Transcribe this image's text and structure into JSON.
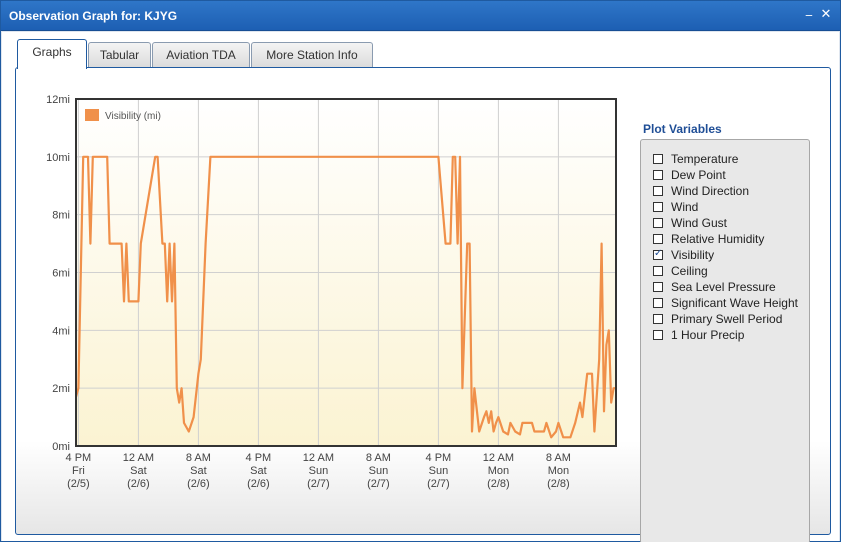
{
  "window": {
    "title": "Observation Graph for: KJYG",
    "minimize_icon": "minimize-icon",
    "close_icon": "close-icon"
  },
  "tabs": [
    {
      "label": "Graphs",
      "active": true
    },
    {
      "label": "Tabular",
      "active": false
    },
    {
      "label": "Aviation TDA",
      "active": false
    },
    {
      "label": "More Station Info",
      "active": false
    }
  ],
  "plot_variables": {
    "title": "Plot Variables",
    "items": [
      {
        "label": "Temperature",
        "checked": false
      },
      {
        "label": "Dew Point",
        "checked": false
      },
      {
        "label": "Wind Direction",
        "checked": false
      },
      {
        "label": "Wind",
        "checked": false
      },
      {
        "label": "Wind Gust",
        "checked": false
      },
      {
        "label": "Relative Humidity",
        "checked": false
      },
      {
        "label": "Visibility",
        "checked": true
      },
      {
        "label": "Ceiling",
        "checked": false
      },
      {
        "label": "Sea Level Pressure",
        "checked": false
      },
      {
        "label": "Significant Wave Height",
        "checked": false
      },
      {
        "label": "Primary Swell Period",
        "checked": false
      },
      {
        "label": "1 Hour Precip",
        "checked": false
      }
    ]
  },
  "colors": {
    "series": "#f0904a",
    "frame": "#333333",
    "plot_bg_top": "#ffffff",
    "plot_bg_bottom": "#fbf3d2"
  },
  "chart_data": {
    "type": "line",
    "legend": "top-left",
    "grid": true,
    "ylim": [
      0,
      12
    ],
    "yticks": [
      0,
      2,
      4,
      6,
      8,
      10,
      12
    ],
    "ytick_labels": [
      "0mi",
      "2mi",
      "4mi",
      "6mi",
      "8mi",
      "10mi",
      "12mi"
    ],
    "xlim": [
      -0.2,
      44.8
    ],
    "xticks": [
      {
        "x": 0,
        "lines": [
          "4 PM",
          "Fri",
          "(2/5)"
        ]
      },
      {
        "x": 5,
        "lines": [
          "12 AM",
          "Sat",
          "(2/6)"
        ]
      },
      {
        "x": 10,
        "lines": [
          "8 AM",
          "Sat",
          "(2/6)"
        ]
      },
      {
        "x": 15,
        "lines": [
          "4 PM",
          "Sat",
          "(2/6)"
        ]
      },
      {
        "x": 20,
        "lines": [
          "12 AM",
          "Sun",
          "(2/7)"
        ]
      },
      {
        "x": 25,
        "lines": [
          "8 AM",
          "Sun",
          "(2/7)"
        ]
      },
      {
        "x": 30,
        "lines": [
          "4 PM",
          "Sun",
          "(2/7)"
        ]
      },
      {
        "x": 35,
        "lines": [
          "12 AM",
          "Mon",
          "(2/8)"
        ]
      },
      {
        "x": 40,
        "lines": [
          "8 AM",
          "Mon",
          "(2/8)"
        ]
      }
    ],
    "series": [
      {
        "name": "Visibility (mi)",
        "x": [
          -0.2,
          0,
          0.4,
          0.8,
          1.0,
          1.2,
          1.4,
          1.6,
          2.4,
          2.6,
          3.0,
          3.6,
          3.8,
          4.0,
          4.2,
          4.6,
          5.0,
          5.2,
          6.4,
          6.6,
          7.0,
          7.2,
          7.4,
          7.6,
          7.8,
          8.0,
          8.2,
          8.4,
          8.6,
          8.8,
          9.2,
          9.6,
          10.0,
          10.2,
          10.4,
          10.6,
          11.0,
          29.8,
          30.0,
          30.6,
          31.0,
          31.2,
          31.4,
          31.6,
          31.8,
          32.0,
          32.4,
          32.6,
          32.8,
          33.0,
          33.4,
          33.8,
          34.0,
          34.2,
          34.4,
          34.6,
          34.8,
          35.0,
          35.4,
          35.8,
          36.0,
          36.4,
          36.8,
          37.0,
          37.4,
          37.8,
          38.0,
          38.4,
          38.8,
          39.0,
          39.4,
          39.8,
          40.0,
          40.4,
          40.8,
          41.0,
          41.4,
          41.8,
          42.0,
          42.4,
          42.8,
          43.0,
          43.4,
          43.6,
          43.8,
          44.0,
          44.2,
          44.4,
          44.6,
          44.8
        ],
        "y": [
          1.7,
          2,
          10,
          10,
          7,
          10,
          10,
          10,
          10,
          7,
          7,
          7,
          5,
          7,
          5,
          5,
          5,
          7,
          10,
          10,
          7,
          7,
          5,
          7,
          5,
          7,
          2,
          1.5,
          2,
          0.8,
          0.5,
          1,
          2.5,
          3,
          5,
          7,
          10,
          10,
          10,
          7,
          7,
          10,
          10,
          7,
          10,
          2,
          7,
          7,
          0.5,
          2,
          0.5,
          1,
          1.2,
          0.8,
          1.2,
          0.5,
          0.8,
          1,
          0.5,
          0.4,
          0.8,
          0.5,
          0.4,
          0.8,
          0.8,
          0.8,
          0.5,
          0.5,
          0.5,
          0.8,
          0.3,
          0.5,
          0.8,
          0.3,
          0.3,
          0.3,
          0.8,
          1.5,
          1,
          2.5,
          2.5,
          0.5,
          3,
          7,
          1.2,
          3.5,
          4,
          1.5,
          2,
          2
        ]
      }
    ]
  }
}
